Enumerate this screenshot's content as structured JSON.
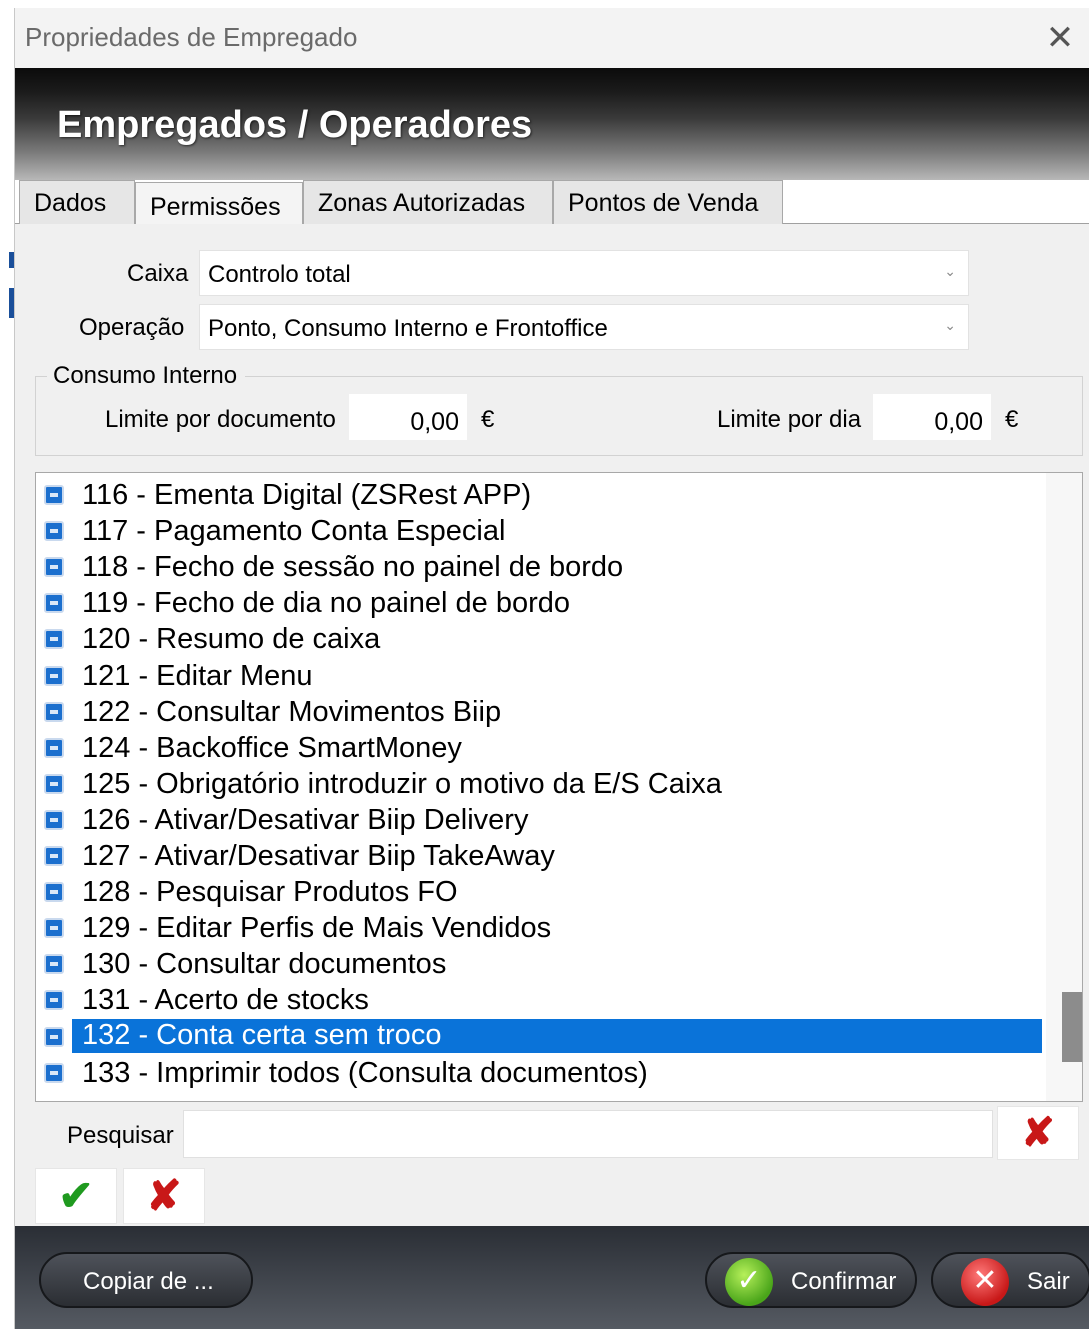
{
  "window": {
    "title": "Propriedades de Empregado",
    "close_glyph": "✕"
  },
  "header": {
    "title": "Empregados / Operadores"
  },
  "tabs": [
    {
      "label": "Dados",
      "active": false
    },
    {
      "label": "Permissões",
      "active": true
    },
    {
      "label": "Zonas Autorizadas",
      "active": false
    },
    {
      "label": "Pontos de Venda",
      "active": false
    }
  ],
  "caixa": {
    "label": "Caixa",
    "value": "Controlo total"
  },
  "operacao": {
    "label": "Operação",
    "value": "Ponto, Consumo Interno e Frontoffice"
  },
  "consumo": {
    "title": "Consumo Interno",
    "limite_documento_label": "Limite por documento",
    "limite_documento_value": "0,00",
    "limite_dia_label": "Limite por dia",
    "limite_dia_value": "0,00",
    "currency": "€"
  },
  "permissions": [
    {
      "text": "116 - Ementa Digital (ZSRest APP)",
      "checked": true,
      "selected": false
    },
    {
      "text": "117 - Pagamento Conta Especial",
      "checked": true,
      "selected": false
    },
    {
      "text": "118 - Fecho de sessão no painel de bordo",
      "checked": true,
      "selected": false
    },
    {
      "text": "119 - Fecho de dia no painel de bordo",
      "checked": true,
      "selected": false
    },
    {
      "text": "120 - Resumo de caixa",
      "checked": true,
      "selected": false
    },
    {
      "text": "121 - Editar Menu",
      "checked": true,
      "selected": false
    },
    {
      "text": "122 - Consultar Movimentos Biip",
      "checked": true,
      "selected": false
    },
    {
      "text": "124 - Backoffice SmartMoney",
      "checked": true,
      "selected": false
    },
    {
      "text": "125 - Obrigatório introduzir o motivo da E/S Caixa",
      "checked": true,
      "selected": false
    },
    {
      "text": "126 - Ativar/Desativar Biip Delivery",
      "checked": true,
      "selected": false
    },
    {
      "text": "127 - Ativar/Desativar Biip TakeAway",
      "checked": true,
      "selected": false
    },
    {
      "text": "128 - Pesquisar Produtos FO",
      "checked": true,
      "selected": false
    },
    {
      "text": "129 - Editar Perfis de Mais Vendidos",
      "checked": true,
      "selected": false
    },
    {
      "text": "130 - Consultar documentos",
      "checked": true,
      "selected": false
    },
    {
      "text": "131 - Acerto de stocks",
      "checked": true,
      "selected": false
    },
    {
      "text": "132 - Conta certa sem troco",
      "checked": true,
      "selected": true
    },
    {
      "text": "133 - Imprimir todos (Consulta documentos)",
      "checked": true,
      "selected": false
    }
  ],
  "list_scroll_position": 0.93,
  "search": {
    "label": "Pesquisar",
    "value": "",
    "clear_glyph": "✘"
  },
  "actions": {
    "apply_glyph": "✔",
    "cancel_glyph": "✘"
  },
  "footer": {
    "copy_label": "Copiar de ...",
    "confirm_label": "Confirmar",
    "exit_label": "Sair",
    "confirm_glyph": "✓",
    "exit_glyph": "✕"
  },
  "colors": {
    "selection": "#0a73d9",
    "checkbox": "#1b6fce",
    "ok_green": "#1f9a1f",
    "cancel_red": "#c81818"
  }
}
